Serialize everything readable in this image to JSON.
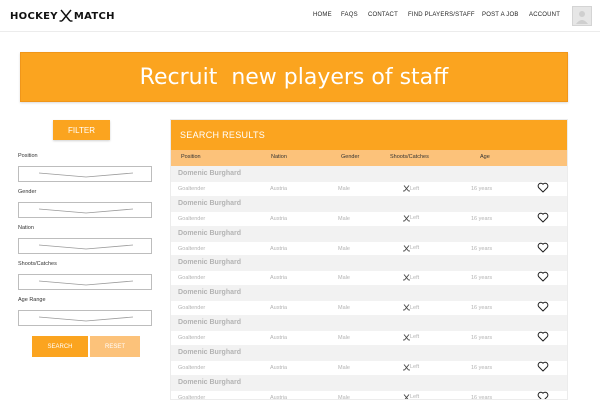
{
  "header": {
    "logo_left": "HOCKEY",
    "logo_right": "MATCH",
    "nav": [
      "HOME",
      "FAQS",
      "CONTACT",
      "FIND PLAYERS/STAFF",
      "POST A JOB",
      "ACCOUNT"
    ]
  },
  "hero": {
    "title": "Recruit  new players of staff"
  },
  "filter": {
    "button_label": "FILTER",
    "fields": [
      "Position",
      "Gender",
      "Nation",
      "Shoots/Catches",
      "Age Range"
    ],
    "search_label": "SEARCH",
    "reset_label": "RESET"
  },
  "results": {
    "title": "SEARCH RESULTS",
    "columns": [
      "Position",
      "Nation",
      "Gender",
      "Shoots/Catches",
      "Age"
    ],
    "rows": [
      {
        "name": "Domenic Burghard",
        "position": "Goaltender",
        "nation": "Austria",
        "gender": "Male",
        "shoots": "Left",
        "age": "16 years"
      },
      {
        "name": "Domenic Burghard",
        "position": "Goaltender",
        "nation": "Austria",
        "gender": "Male",
        "shoots": "Left",
        "age": "16 years"
      },
      {
        "name": "Domenic Burghard",
        "position": "Goaltender",
        "nation": "Austria",
        "gender": "Male",
        "shoots": "Left",
        "age": "16 years"
      },
      {
        "name": "Domenic Burghard",
        "position": "Goaltender",
        "nation": "Austria",
        "gender": "Male",
        "shoots": "Left",
        "age": "16 years"
      },
      {
        "name": "Domenic Burghard",
        "position": "Goaltender",
        "nation": "Austria",
        "gender": "Male",
        "shoots": "Left",
        "age": "16 years"
      },
      {
        "name": "Domenic Burghard",
        "position": "Goaltender",
        "nation": "Austria",
        "gender": "Male",
        "shoots": "Left",
        "age": "16 years"
      },
      {
        "name": "Domenic Burghard",
        "position": "Goaltender",
        "nation": "Austria",
        "gender": "Male",
        "shoots": "Left",
        "age": "16 years"
      },
      {
        "name": "Domenic Burghard",
        "position": "Goaltender",
        "nation": "Austria",
        "gender": "Male",
        "shoots": "Left",
        "age": "16 years"
      }
    ]
  },
  "colors": {
    "accent": "#fba41f",
    "accent_light": "#fcc27a"
  },
  "icons": {
    "row_action": "heart-icon",
    "shoots": "hockey-stick-icon"
  }
}
